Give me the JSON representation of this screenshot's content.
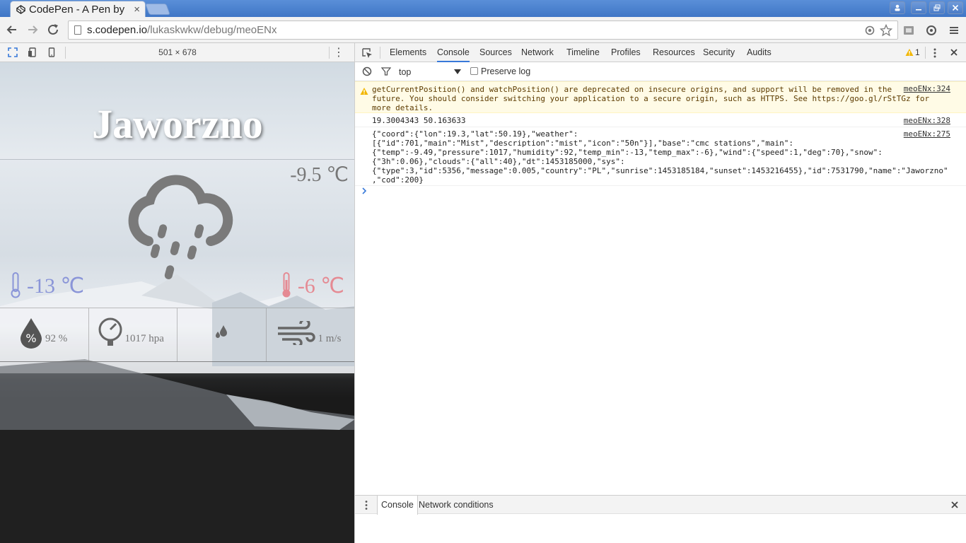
{
  "browser": {
    "tab_title": "CodePen - A Pen by",
    "tab_close": "×",
    "url_host": "s.codepen.io",
    "url_path": "/lukaskwkw/debug/meoENx"
  },
  "device": {
    "dimensions": "501 × 678",
    "menu": "⋮"
  },
  "weather_app": {
    "city": "Jaworzno",
    "temp_now": "-9.5 ℃",
    "temp_min": "-13 ℃",
    "temp_max": "-6 ℃",
    "humidity": "92 %",
    "pressure": "1017 hpa",
    "precip": "",
    "wind": "1 m/s",
    "min_color": "#8a95d8",
    "max_color": "#e58a93"
  },
  "devtools": {
    "tabs": [
      "Elements",
      "Console",
      "Sources",
      "Network",
      "Timeline",
      "Profiles",
      "Resources",
      "Security",
      "Audits"
    ],
    "active_tab": "Console",
    "warning_count": "1",
    "context": "top",
    "preserve_log": "Preserve log",
    "messages": {
      "warning": {
        "text": "getCurrentPosition() and watchPosition() are deprecated on insecure origins, and support will be removed in the\nfuture. You should consider switching your application to a secure origin, such as HTTPS. See https://goo.gl/rStTGz for\nmore details.",
        "source": "meoENx:324"
      },
      "log1": {
        "text": "19.3004343 50.163633",
        "source": "meoENx:328"
      },
      "log2": {
        "text": "{\"coord\":{\"lon\":19.3,\"lat\":50.19},\"weather\":\n[{\"id\":701,\"main\":\"Mist\",\"description\":\"mist\",\"icon\":\"50n\"}],\"base\":\"cmc stations\",\"main\":\n{\"temp\":-9.49,\"pressure\":1017,\"humidity\":92,\"temp_min\":-13,\"temp_max\":-6},\"wind\":{\"speed\":1,\"deg\":70},\"snow\":\n{\"3h\":0.06},\"clouds\":{\"all\":40},\"dt\":1453185000,\"sys\":\n{\"type\":3,\"id\":5356,\"message\":0.005,\"country\":\"PL\",\"sunrise\":1453185184,\"sunset\":1453216455},\"id\":7531790,\"name\":\"Jaworzno\"\n,\"cod\":200}",
        "source": "meoENx:275"
      }
    },
    "drawer_tabs": [
      "Console",
      "Network conditions"
    ]
  }
}
